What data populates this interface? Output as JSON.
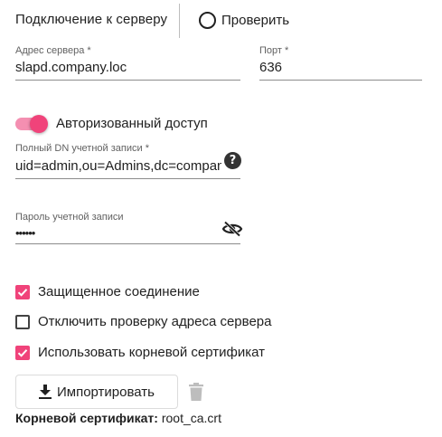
{
  "header": {
    "title": "Подключение к серверу",
    "check_label": "Проверить"
  },
  "server": {
    "address_label": "Адрес сервера *",
    "address_value": "slapd.company.loc",
    "port_label": "Порт *",
    "port_value": "636"
  },
  "auth": {
    "toggle_on": true,
    "toggle_label": "Авторизованный доступ",
    "dn_label": "Полный DN учетной записи *",
    "dn_value": "uid=admin,ou=Admins,dc=company,dc=loc",
    "password_label": "Пароль учетной записи",
    "password_value": "••••••"
  },
  "options": [
    {
      "label": "Защищенное соединение",
      "checked": true
    },
    {
      "label": "Отключить проверку адреса сервера",
      "checked": false
    },
    {
      "label": "Использовать корневой сертификат",
      "checked": true
    }
  ],
  "certificate": {
    "import_label": "Импортировать",
    "caption": "Корневой сертификат:",
    "filename": "root_ca.crt"
  },
  "icons": {
    "check": "radio-circle-icon",
    "help": "help-circle-icon",
    "visibility": "eye-off-icon",
    "import": "download-icon",
    "delete": "trash-icon"
  },
  "colors": {
    "accent": "#f0437a",
    "accent_light": "#f48fb1",
    "disabled_icon": "#bdbdbd"
  }
}
